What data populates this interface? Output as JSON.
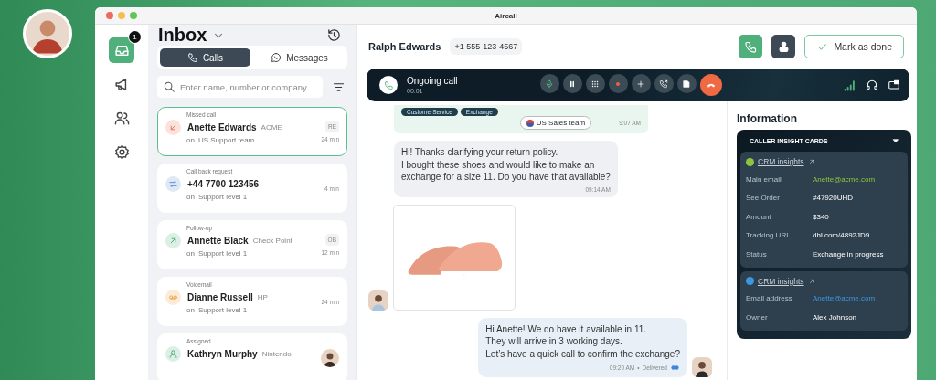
{
  "window": {
    "title": "Aircall"
  },
  "nav": {
    "items": [
      {
        "kind": "inbox",
        "selected": true,
        "badge": "1"
      },
      {
        "kind": "megaphone",
        "selected": false
      },
      {
        "kind": "people",
        "selected": false
      },
      {
        "kind": "settings",
        "selected": false
      }
    ]
  },
  "inbox": {
    "title": "Inbox",
    "tabs": [
      {
        "label": "Calls",
        "kind": "calls",
        "selected": true
      },
      {
        "label": "Messages",
        "kind": "messages",
        "selected": false
      }
    ],
    "search": {
      "placeholder": "Enter name, number or company..."
    },
    "calls": [
      {
        "kind": "missed",
        "type": "Missed call",
        "name": "Anette Edwards",
        "company": "ACME",
        "prefix": "on",
        "team": "US Support team",
        "initials": "RE",
        "time": "24 min",
        "selected": true
      },
      {
        "kind": "callback",
        "type": "Call back request",
        "name": "+44 7700 123456",
        "prefix": "on",
        "team": "Support level 1",
        "time": "4 min",
        "selected": false
      },
      {
        "kind": "followup",
        "type": "Follow-up",
        "name": "Annette Black",
        "company": "Check Point",
        "prefix": "on",
        "team": "Support level 1",
        "initials": "OB",
        "time": "12 min",
        "selected": false
      },
      {
        "kind": "voicemail",
        "type": "Voicemail",
        "name": "Dianne Russell",
        "company": "HP",
        "prefix": "on",
        "team": "Support level 1",
        "time": "24 min",
        "selected": false
      },
      {
        "kind": "assigned",
        "type": "Assigned",
        "name": "Kathryn Murphy",
        "company": "Nintendo",
        "selected": false
      }
    ]
  },
  "conversation": {
    "contact": "Ralph Edwards",
    "phone": "+1 555-123-4567",
    "done_button": "Mark as done",
    "call_bar": {
      "status": "Ongoing call",
      "timer": "00:01",
      "controls": [
        {
          "kind": "mic"
        },
        {
          "kind": "pause"
        },
        {
          "kind": "keypad"
        },
        {
          "kind": "record"
        },
        {
          "kind": "add"
        },
        {
          "kind": "transfer"
        },
        {
          "kind": "note"
        },
        {
          "kind": "hangup"
        }
      ]
    },
    "event": {
      "tags": [
        "CustomerService",
        "Exchange"
      ],
      "team": "US Sales team",
      "time": "9:07 AM"
    },
    "messages": [
      {
        "kind": "incoming",
        "text": "Hi! Thanks clarifying your return policy.\nI bought these shoes and would like to make an\nexchange for a size 11. Do you have that available?",
        "time": "09:14 AM"
      },
      {
        "kind": "image"
      },
      {
        "kind": "outgoing",
        "text": "Hi Anette! We do have it available in 11.\nThey will arrive in 3 working days.\nLet’s have a quick call to confirm the exchange?",
        "time": "09:20 AM",
        "separator": "•",
        "status": "Delivered"
      }
    ]
  },
  "information": {
    "title": "Information",
    "section": "CALLER INSIGHT CARDS",
    "expanded": true,
    "cards": [
      {
        "title": "CRM insights",
        "color": "#8cc63f",
        "fields": [
          {
            "label": "Main email",
            "value": "Anette@acme.com",
            "kind": "link"
          },
          {
            "label": "See Order",
            "value": "#47920UHD",
            "kind": "text"
          },
          {
            "label": "Amount",
            "value": "$340",
            "kind": "text"
          },
          {
            "label": "Tracking URL",
            "value": "dhl.com/4892JD9",
            "kind": "text"
          },
          {
            "label": "Status",
            "value": "Exchange in progress",
            "kind": "text"
          }
        ]
      },
      {
        "title": "CRM insights",
        "color": "#3d96e0",
        "fields": [
          {
            "label": "Email address",
            "value": "Anette@acme.com",
            "kind": "link"
          },
          {
            "label": "Owner",
            "value": "Alex Johnson",
            "kind": "text"
          }
        ]
      }
    ]
  }
}
